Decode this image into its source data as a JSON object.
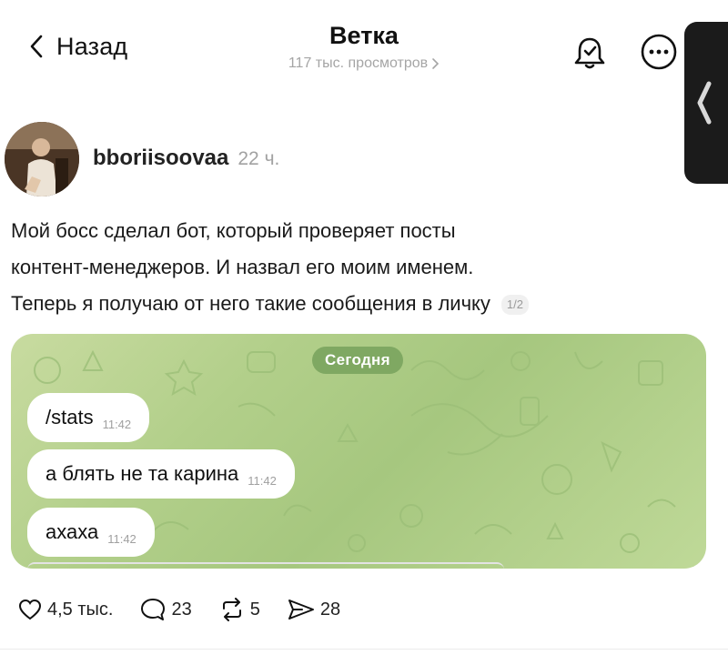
{
  "header": {
    "back_label": "Назад",
    "title": "Ветка",
    "views": "117 тыс. просмотров",
    "icons": [
      "chevron-left-icon",
      "bell-icon",
      "more-icon"
    ]
  },
  "post": {
    "author": "bboriisoovaa",
    "time": "22 ч.",
    "text_lines": [
      "Мой босс сделал бот, который проверяет посты",
      "контент-менеджеров. И назвал его моим именем.",
      "Теперь я получаю от него такие сообщения в личку"
    ],
    "pager": "1/2"
  },
  "media": {
    "date_label": "Сегодня",
    "messages": [
      {
        "text": "/stats",
        "time": "11:42"
      },
      {
        "text": "а блять не та карина",
        "time": "11:42"
      },
      {
        "text": "ахаха",
        "time": "11:42"
      }
    ],
    "background_color": "#b2cf8a",
    "pill_color": "#7fa862"
  },
  "actions": {
    "likes": "4,5 тыс.",
    "comments": "23",
    "reposts": "5",
    "shares": "28"
  }
}
